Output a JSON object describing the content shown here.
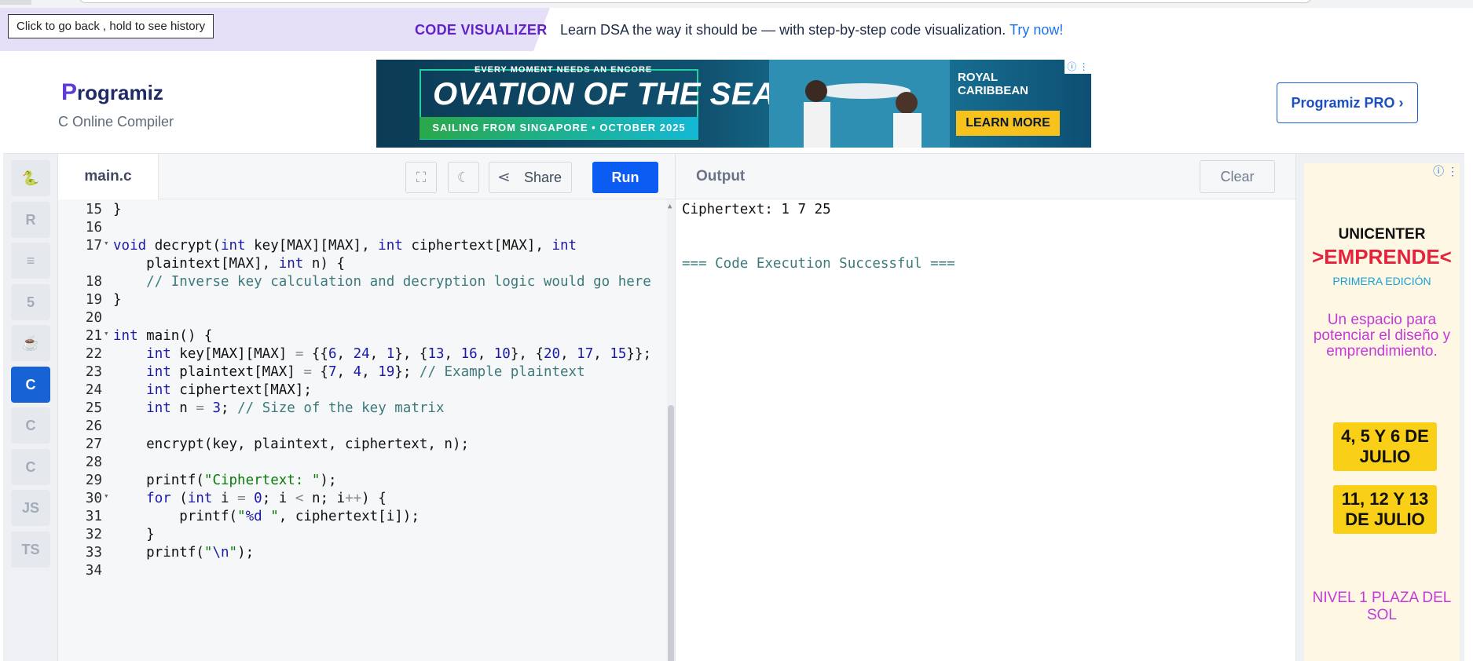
{
  "tooltip": "Click to go back , hold to see history",
  "promo": {
    "title": "CODE VISUALIZER",
    "text": "Learn DSA the way it should be — with step-by-step code visualization.",
    "link": "Try now!"
  },
  "header": {
    "logo": "rogramiz",
    "logo_initial": "P",
    "compiler_name": "C Online Compiler",
    "pro_button": "Programiz PRO ›"
  },
  "ad": {
    "small": "EVERY MOMENT NEEDS AN ENCORE",
    "big": "OVATION OF THE SEAS",
    "sub": "SAILING FROM SINGAPORE • OCTOBER 2025",
    "brand_line1": "ROYAL",
    "brand_line2": "CARIBBEAN",
    "cta": "LEARN MORE"
  },
  "languages": [
    {
      "name": "python",
      "glyph": "🐍"
    },
    {
      "name": "r",
      "glyph": "R"
    },
    {
      "name": "sql",
      "glyph": "≡"
    },
    {
      "name": "html",
      "glyph": "5"
    },
    {
      "name": "java",
      "glyph": "☕"
    },
    {
      "name": "c",
      "glyph": "C",
      "active": true
    },
    {
      "name": "cpp",
      "glyph": "C"
    },
    {
      "name": "csharp",
      "glyph": "C"
    },
    {
      "name": "javascript",
      "glyph": "JS"
    },
    {
      "name": "typescript",
      "glyph": "TS"
    }
  ],
  "editor": {
    "file_tab": "main.c",
    "share_label": "Share",
    "run_label": "Run"
  },
  "code_lines": [
    {
      "n": "15",
      "fold": false,
      "html": "}"
    },
    {
      "n": "16",
      "fold": false,
      "html": ""
    },
    {
      "n": "17",
      "fold": true,
      "html": "<span class=\"kw\">void</span> decrypt(<span class=\"kw\">int</span> key[MAX][MAX], <span class=\"kw\">int</span> ciphertext[MAX], <span class=\"kw\">int</span>"
    },
    {
      "n": "",
      "fold": false,
      "html": "    plaintext[MAX], <span class=\"kw\">int</span> n) {"
    },
    {
      "n": "18",
      "fold": false,
      "html": "    <span class=\"cmt\">// Inverse key calculation and decryption logic would go here</span>"
    },
    {
      "n": "19",
      "fold": false,
      "html": "}"
    },
    {
      "n": "20",
      "fold": false,
      "html": ""
    },
    {
      "n": "21",
      "fold": true,
      "html": "<span class=\"kw\">int</span> main() {"
    },
    {
      "n": "22",
      "fold": false,
      "html": "    <span class=\"kw\">int</span> key[MAX][MAX] <span class=\"op\">=</span> {{<span class=\"num\">6</span>, <span class=\"num\">24</span>, <span class=\"num\">1</span>}, {<span class=\"num\">13</span>, <span class=\"num\">16</span>, <span class=\"num\">10</span>}, {<span class=\"num\">20</span>, <span class=\"num\">17</span>, <span class=\"num\">15</span>}};"
    },
    {
      "n": "23",
      "fold": false,
      "html": "    <span class=\"kw\">int</span> plaintext[MAX] <span class=\"op\">=</span> {<span class=\"num\">7</span>, <span class=\"num\">4</span>, <span class=\"num\">19</span>}; <span class=\"cmt\">// Example plaintext</span>"
    },
    {
      "n": "24",
      "fold": false,
      "html": "    <span class=\"kw\">int</span> ciphertext[MAX];"
    },
    {
      "n": "25",
      "fold": false,
      "html": "    <span class=\"kw\">int</span> n <span class=\"op\">=</span> <span class=\"num\">3</span>; <span class=\"cmt\">// Size of the key matrix</span>"
    },
    {
      "n": "26",
      "fold": false,
      "html": ""
    },
    {
      "n": "27",
      "fold": false,
      "html": "    encrypt(key, plaintext, ciphertext, n);"
    },
    {
      "n": "28",
      "fold": false,
      "html": ""
    },
    {
      "n": "29",
      "fold": false,
      "html": "    printf(<span class=\"str\">\"Ciphertext: \"</span>);"
    },
    {
      "n": "30",
      "fold": true,
      "html": "    <span class=\"kw\">for</span> (<span class=\"kw\">int</span> i <span class=\"op\">=</span> <span class=\"num\">0</span>; i <span class=\"op\">&lt;</span> n; i<span class=\"op\">++</span>) {"
    },
    {
      "n": "31",
      "fold": false,
      "html": "        printf(<span class=\"str\">\"<span class=\"esc\">%d</span> \"</span>, ciphertext[i]);"
    },
    {
      "n": "32",
      "fold": false,
      "html": "    }"
    },
    {
      "n": "33",
      "fold": false,
      "html": "    printf(<span class=\"str\">\"<span class=\"esc\">\\n</span>\"</span>);"
    },
    {
      "n": "34",
      "fold": false,
      "html": ""
    }
  ],
  "output": {
    "label": "Output",
    "clear_label": "Clear",
    "lines": [
      "Ciphertext: 1 7 25",
      "",
      "",
      "=== Code Execution Successful ==="
    ]
  },
  "side_ad": {
    "t1": "UNICENTER",
    "t2": ">EMPRENDE<",
    "t3": "PRIMERA EDICIÓN",
    "t4": "Un espacio para potenciar el diseño y emprendimiento.",
    "date1": "4, 5 Y 6 DE JULIO",
    "date2": "11, 12 Y 13 DE JULIO",
    "t5": "NIVEL 1 PLAZA DEL SOL"
  },
  "colors": {
    "run": "#0b5cf2",
    "brand": "#5d3dd6",
    "promo_title": "#6023c6",
    "link": "#1a73e8"
  }
}
